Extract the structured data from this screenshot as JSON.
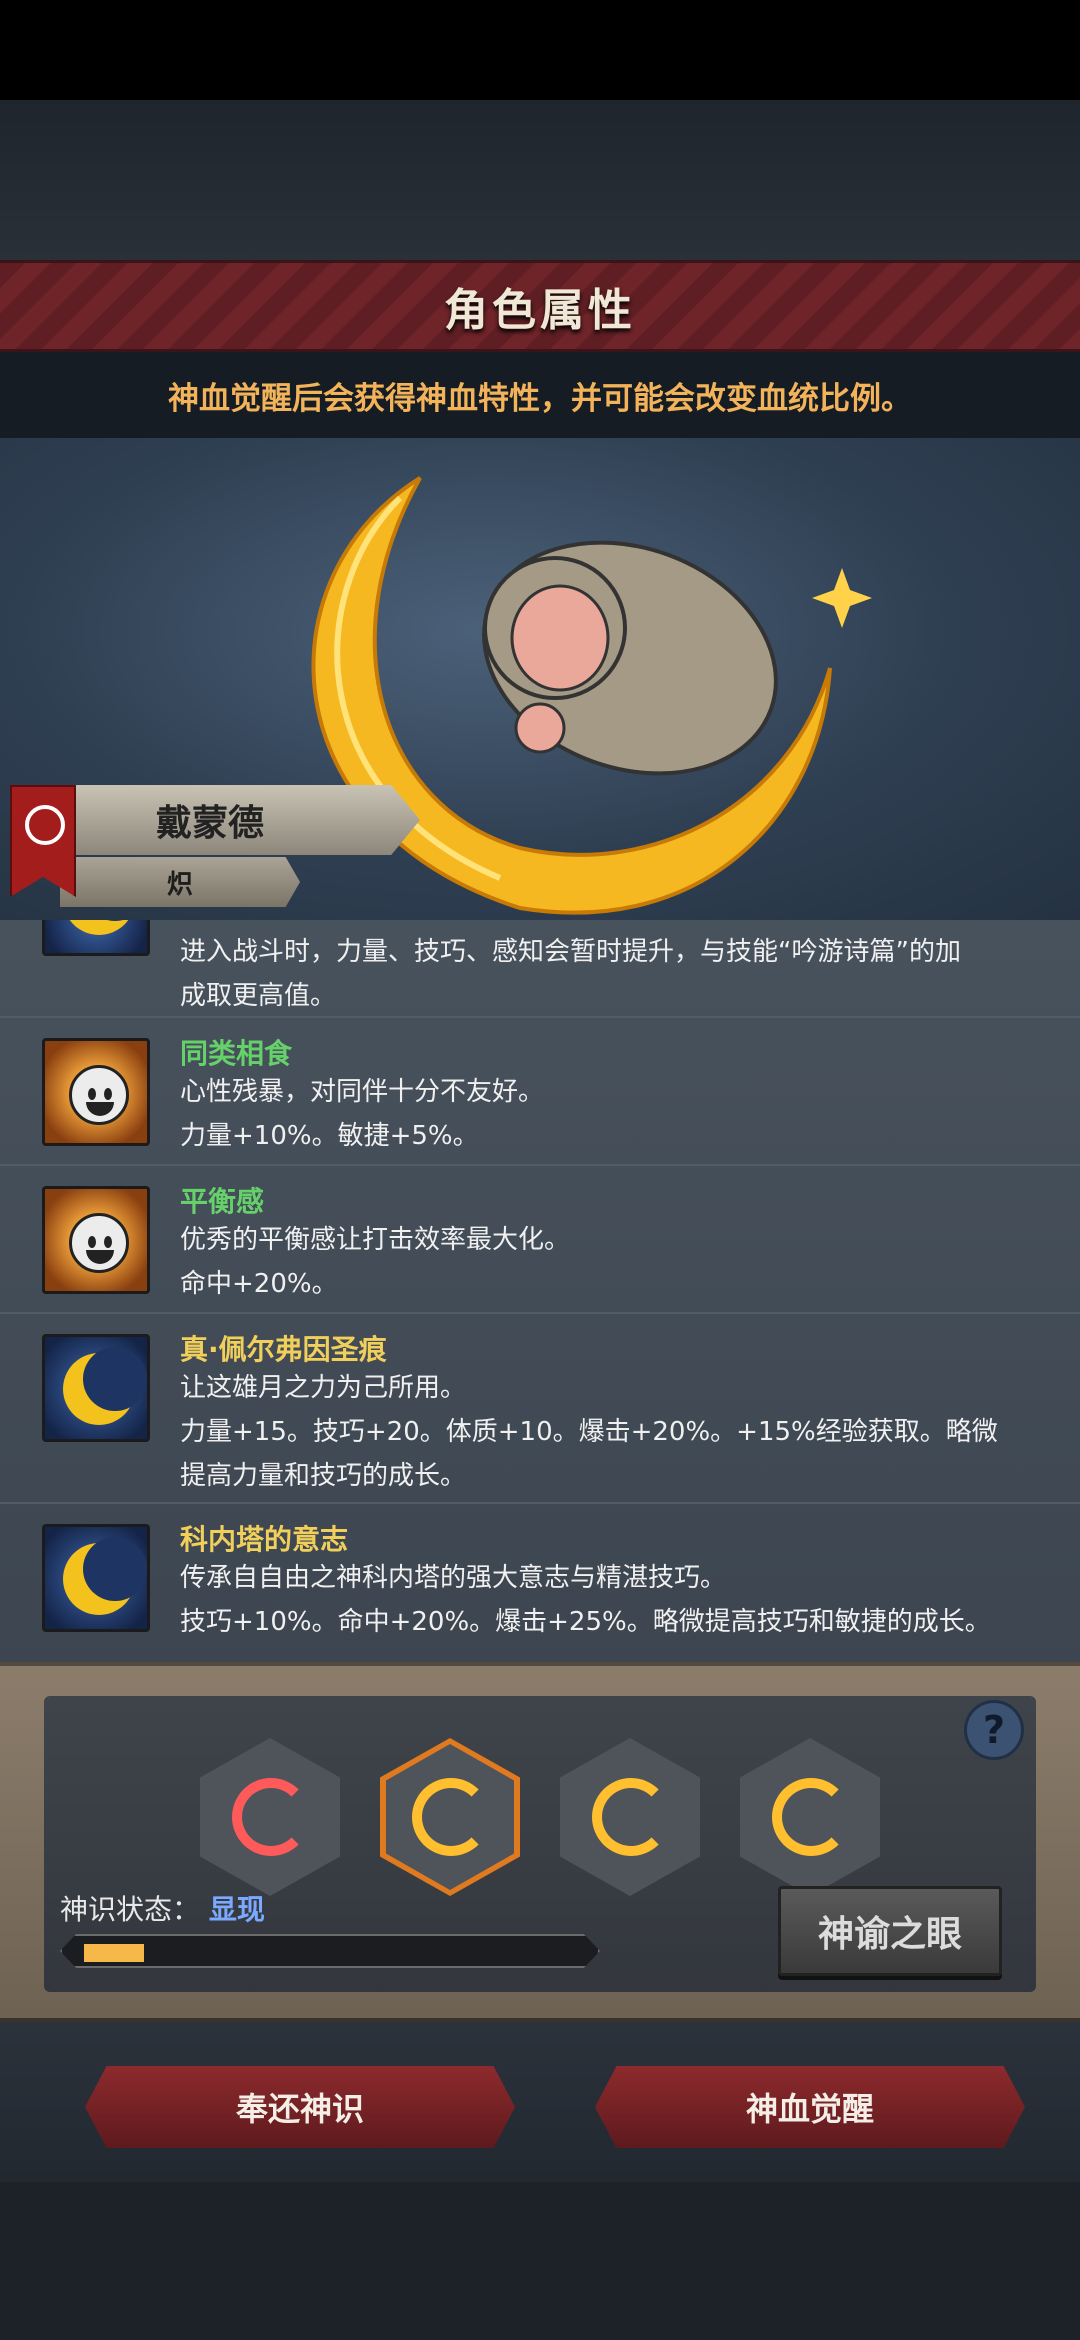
{
  "title": "角色属性",
  "notice": "神血觉醒后会获得神血特性，并可能会改变血统比例。",
  "character": {
    "name": "戴蒙德",
    "subtitle": "炽"
  },
  "traits": [
    {
      "name": "",
      "lines": [
        "进入战斗时，力量、技巧、感知会暂时提升，与技能“吟游诗篇”的加",
        "成取更高值。"
      ],
      "icon": "moon-icon",
      "color": ""
    },
    {
      "name": "同类相食",
      "lines": [
        "心性残暴，对同伴十分不友好。",
        "力量+10%。敏捷+5%。"
      ],
      "icon": "smiley-icon",
      "color": "green"
    },
    {
      "name": "平衡感",
      "lines": [
        "优秀的平衡感让打击效率最大化。",
        "命中+20%。"
      ],
      "icon": "smiley-icon",
      "color": "green"
    },
    {
      "name": "真·佩尔弗因圣痕",
      "lines": [
        "让这雄月之力为己所用。",
        "力量+15。技巧+20。体质+10。爆击+20%。+15%经验获取。略微",
        "提高力量和技巧的成长。"
      ],
      "icon": "moon-icon",
      "color": "gold"
    },
    {
      "name": "科内塔的意志",
      "lines": [
        "传承自自由之神科内塔的强大意志与精湛技巧。",
        "技巧+10%。命中+20%。爆击+25%。略微提高技巧和敏捷的成长。"
      ],
      "icon": "moon-icon",
      "color": "gold"
    }
  ],
  "panel": {
    "status_label": "神识状态：",
    "status_value": "显现",
    "progress": 0.12,
    "eye_button": "神谕之眼",
    "help": "?",
    "slots": [
      "red-moon-slot",
      "gold-moon-slot-selected",
      "gold-moon-slot",
      "gold-moon-slot"
    ]
  },
  "buttons": {
    "return": "奉还神识",
    "awaken": "神血觉醒"
  },
  "colors": {
    "accent_gold": "#f1cf5b",
    "accent_green": "#66d16a",
    "banner_red": "#6e2429",
    "orange": "#f2b35a"
  }
}
